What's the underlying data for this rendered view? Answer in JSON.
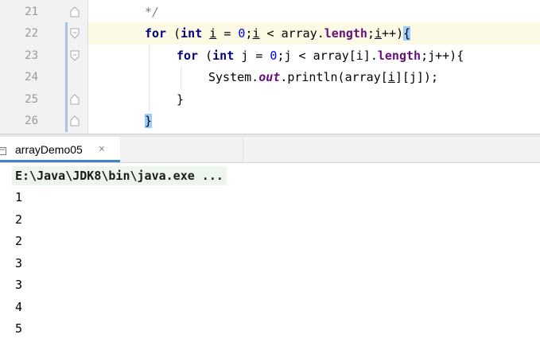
{
  "editor": {
    "lines": [
      {
        "num": "21",
        "tokens": [
          {
            "t": "*/",
            "c": "cmt"
          }
        ]
      },
      {
        "num": "22",
        "tokens": [
          {
            "t": "for",
            "c": "kw"
          },
          {
            "t": " (",
            "c": ""
          },
          {
            "t": "int",
            "c": "kw"
          },
          {
            "t": " ",
            "c": ""
          },
          {
            "t": "i",
            "c": "ul"
          },
          {
            "t": " = ",
            "c": ""
          },
          {
            "t": "0",
            "c": "num"
          },
          {
            "t": ";",
            "c": ""
          },
          {
            "t": "i",
            "c": "ul"
          },
          {
            "t": " < array.",
            "c": ""
          },
          {
            "t": "length",
            "c": "fld"
          },
          {
            "t": ";",
            "c": ""
          },
          {
            "t": "i",
            "c": "ul"
          },
          {
            "t": "++)",
            "c": ""
          },
          {
            "t": "{",
            "c": "brace-hl"
          }
        ]
      },
      {
        "num": "23",
        "tokens": [
          {
            "t": "for",
            "c": "kw"
          },
          {
            "t": " (",
            "c": ""
          },
          {
            "t": "int",
            "c": "kw"
          },
          {
            "t": " j = ",
            "c": ""
          },
          {
            "t": "0",
            "c": "num"
          },
          {
            "t": ";j < array[i].",
            "c": ""
          },
          {
            "t": "length",
            "c": "fld"
          },
          {
            "t": ";j++){",
            "c": ""
          }
        ]
      },
      {
        "num": "24",
        "tokens": [
          {
            "t": "System.",
            "c": ""
          },
          {
            "t": "out",
            "c": "stat"
          },
          {
            "t": ".println(array[",
            "c": ""
          },
          {
            "t": "i",
            "c": "ul"
          },
          {
            "t": "][j]);",
            "c": ""
          }
        ]
      },
      {
        "num": "25",
        "tokens": [
          {
            "t": "}",
            "c": ""
          }
        ]
      },
      {
        "num": "26",
        "tokens": [
          {
            "t": "}",
            "c": "brace-hl"
          }
        ]
      }
    ]
  },
  "run": {
    "tab_label": "arrayDemo05",
    "close_glyph": "×",
    "command": "E:\\Java\\JDK8\\bin\\java.exe ...",
    "output": [
      "1",
      "2",
      "2",
      "3",
      "3",
      "4",
      "5"
    ]
  }
}
